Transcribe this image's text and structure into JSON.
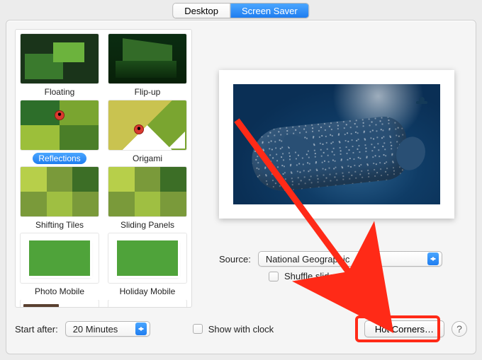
{
  "tabs": {
    "desktop": "Desktop",
    "screensaver": "Screen Saver",
    "active": "screensaver"
  },
  "savers": [
    {
      "id": "floating",
      "label": "Floating",
      "selected": false
    },
    {
      "id": "flipup",
      "label": "Flip-up",
      "selected": false
    },
    {
      "id": "reflect",
      "label": "Reflections",
      "selected": true
    },
    {
      "id": "origami",
      "label": "Origami",
      "selected": false
    },
    {
      "id": "shifting",
      "label": "Shifting Tiles",
      "selected": false
    },
    {
      "id": "sliding",
      "label": "Sliding Panels",
      "selected": false
    },
    {
      "id": "photomob",
      "label": "Photo Mobile",
      "selected": false
    },
    {
      "id": "holiday",
      "label": "Holiday Mobile",
      "selected": false
    }
  ],
  "source": {
    "label": "Source:",
    "value": "National Geographic"
  },
  "shuffle": {
    "label": "Shuffle slide order",
    "checked": false
  },
  "start": {
    "label": "Start after:",
    "value": "20 Minutes"
  },
  "showClock": {
    "label": "Show with clock",
    "checked": false
  },
  "hotCorners": "Hot Corners…",
  "helpGlyph": "?",
  "annotation": {
    "arrowColor": "#ff2a17"
  }
}
